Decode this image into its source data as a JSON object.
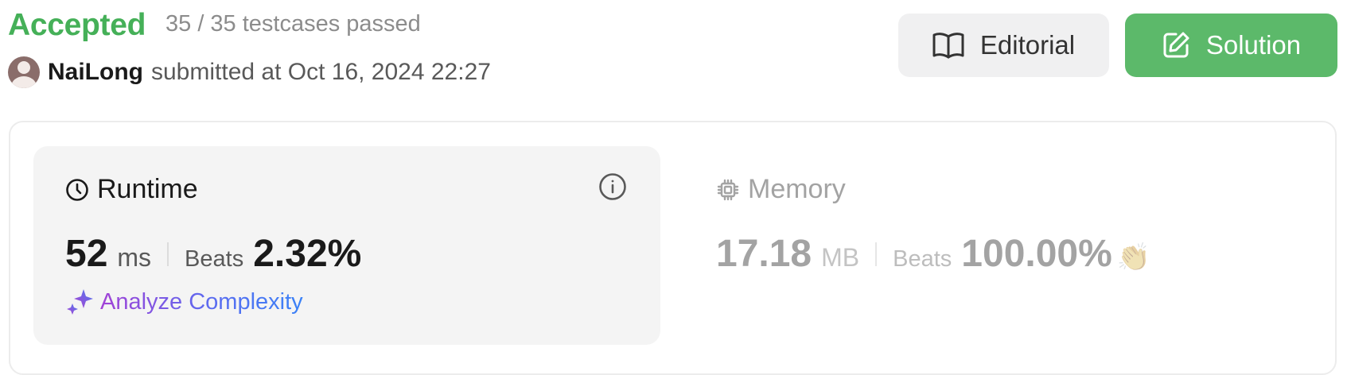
{
  "header": {
    "status": "Accepted",
    "testcases": "35 / 35 testcases passed",
    "username": "NaiLong",
    "submitted_text": "submitted at Oct 16, 2024 22:27"
  },
  "buttons": {
    "editorial": "Editorial",
    "solution": "Solution"
  },
  "runtime": {
    "title": "Runtime",
    "value": "52",
    "unit": "ms",
    "beats_label": "Beats",
    "beats_value": "2.32%"
  },
  "memory": {
    "title": "Memory",
    "value": "17.18",
    "unit": "MB",
    "beats_label": "Beats",
    "beats_value": "100.00%"
  },
  "analyze": {
    "label": "Analyze Complexity"
  },
  "icons": [
    "avatar",
    "book-icon",
    "edit-icon",
    "clock-icon",
    "info-icon",
    "cpu-icon",
    "waving-hands-icon",
    "sparkle-icon"
  ],
  "colors": {
    "accepted": "#45b058",
    "solution_button": "#5cb96a",
    "editorial_button": "#f0f0f1"
  }
}
